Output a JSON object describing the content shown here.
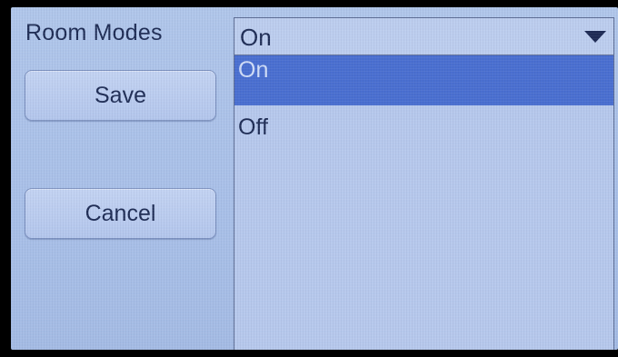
{
  "title": "Room Modes",
  "buttons": {
    "save": "Save",
    "cancel": "Cancel"
  },
  "dropdown": {
    "selected": "On",
    "options": [
      "On",
      "Off"
    ],
    "highlighted_option": "On"
  },
  "colors": {
    "background": "#aec4ea",
    "highlight": "#4a6fd0",
    "text": "#1f2d55"
  }
}
